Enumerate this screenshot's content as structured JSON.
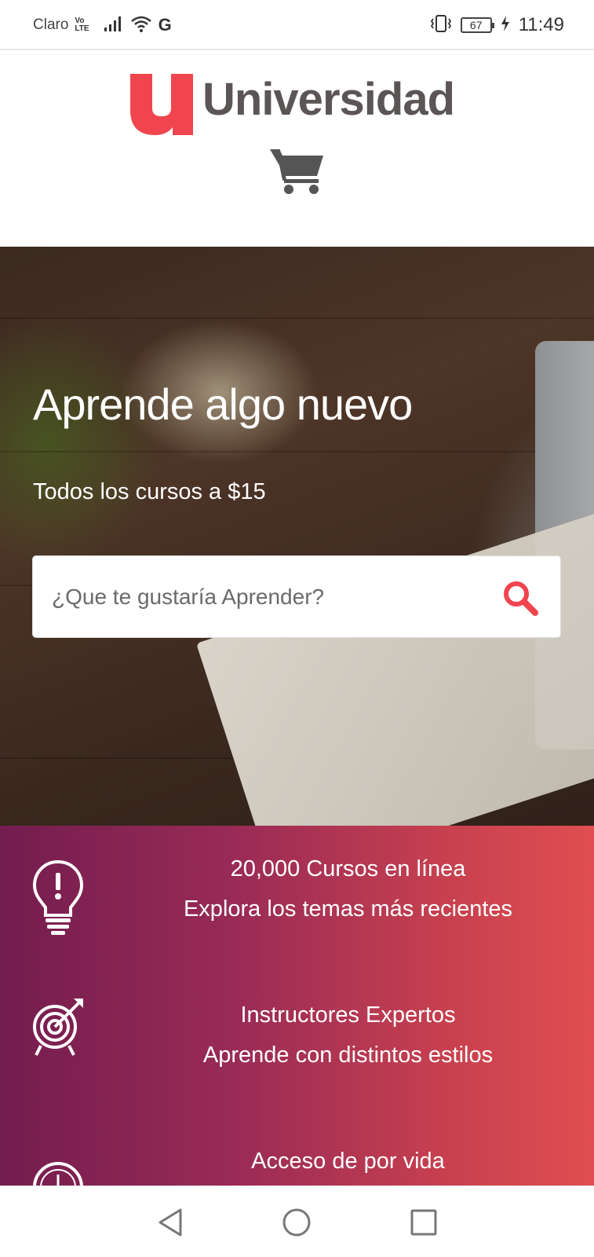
{
  "status_bar": {
    "carrier": "Claro",
    "volte_top": "Vo",
    "volte_bottom": "LTE",
    "network_type": "G",
    "battery": "67",
    "time": "11:49"
  },
  "header": {
    "logo_text": "Universidad",
    "brand_color": "#f0454f",
    "cart_icon": "cart-icon"
  },
  "hero": {
    "title": "Aprende algo nuevo",
    "subtitle": "Todos los cursos a $15",
    "search": {
      "placeholder": "¿Que te gustaría Aprender?",
      "value": "",
      "icon": "search-icon",
      "icon_color": "#f0454f"
    }
  },
  "features": {
    "gradient_start": "#731d4f",
    "gradient_end": "#e04e51",
    "items": [
      {
        "icon": "lightbulb-icon",
        "line1": "20,000 Cursos en línea",
        "line2": "Explora los temas más recientes"
      },
      {
        "icon": "target-icon",
        "line1": "Instructores Expertos",
        "line2": "Aprende con distintos estilos"
      },
      {
        "icon": "clock-icon",
        "line1": "Acceso de por vida",
        "line2": ""
      }
    ]
  },
  "nav_bar": {
    "back": "back-icon",
    "home": "home-icon",
    "recents": "recents-icon"
  }
}
